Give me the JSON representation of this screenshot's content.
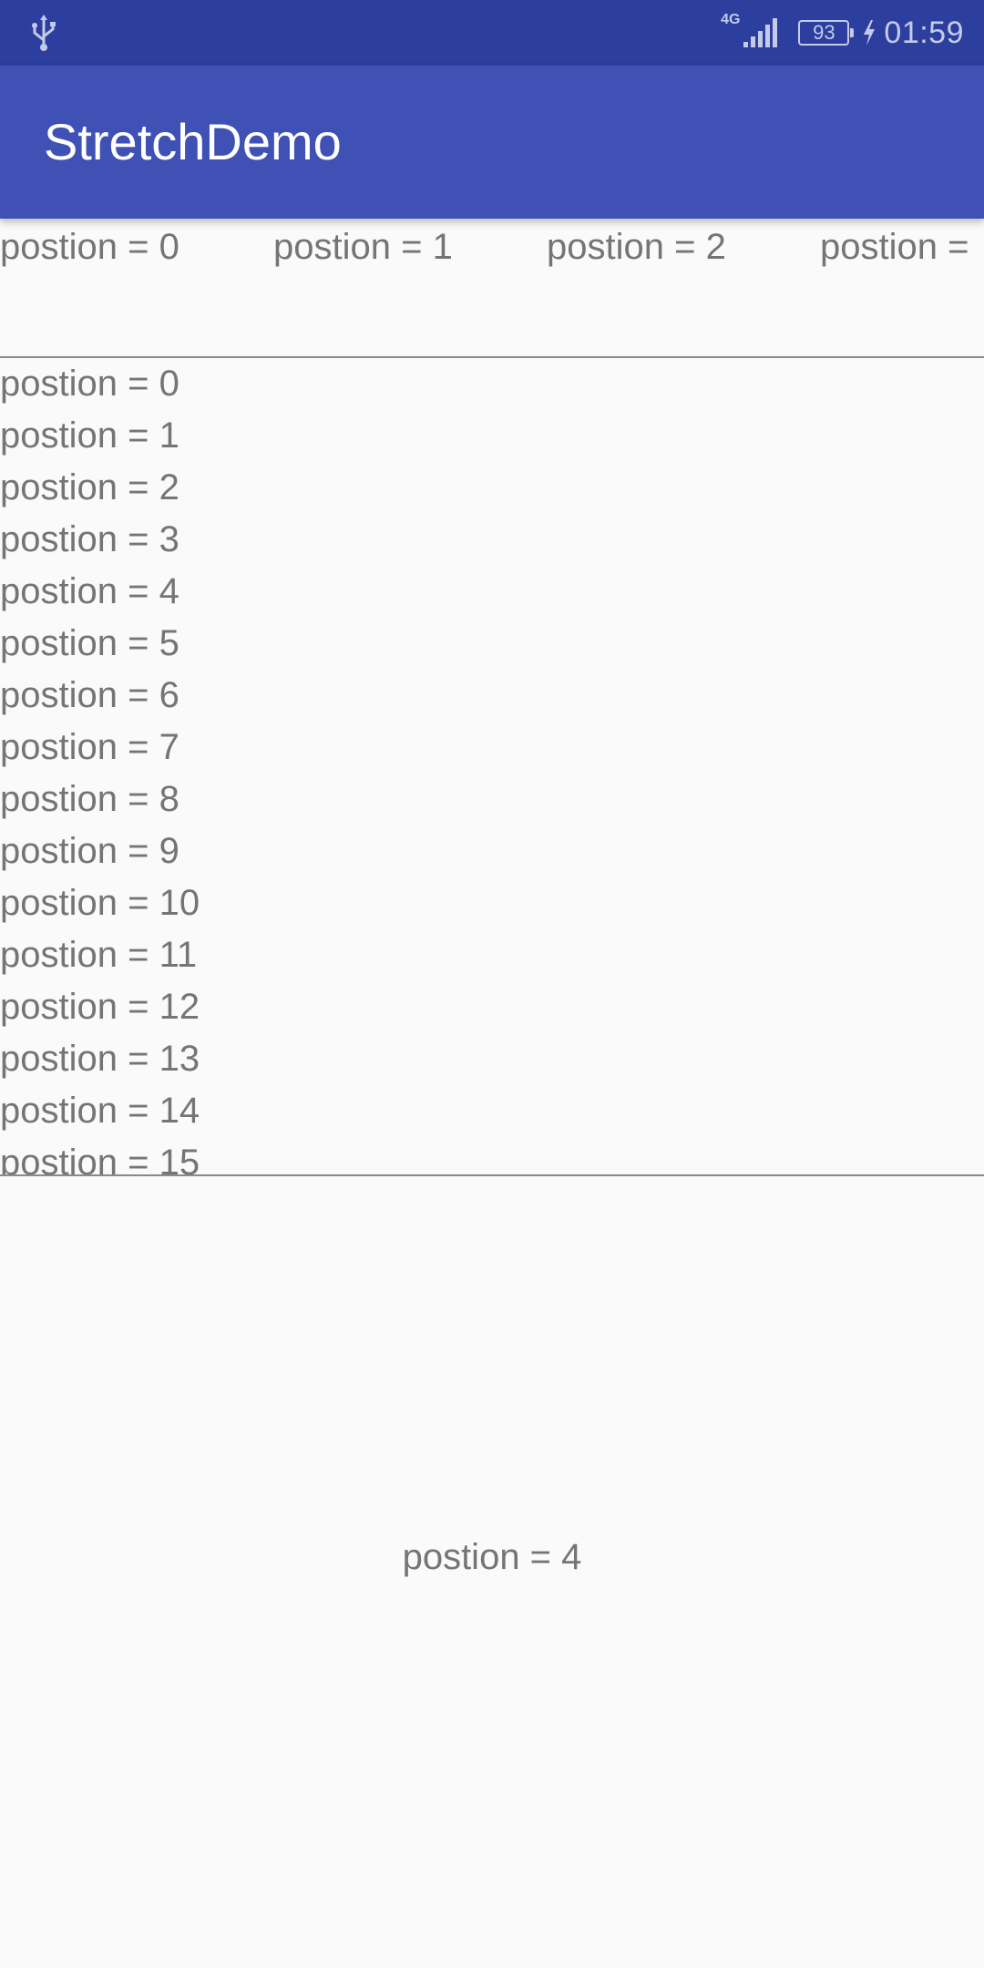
{
  "status_bar": {
    "network": "4G",
    "battery": "93",
    "time": "01:59",
    "icons": [
      "usb-icon",
      "signal-icon",
      "battery-icon",
      "charging-icon"
    ],
    "color": "#2C3E9E"
  },
  "app_bar": {
    "title": "StretchDemo",
    "color": "#3F51B5"
  },
  "horizontal_list": {
    "items": [
      "postion = 0",
      "postion = 1",
      "postion = 2",
      "postion ="
    ]
  },
  "vertical_list": {
    "items": [
      "postion = 0",
      "postion = 1",
      "postion = 2",
      "postion = 3",
      "postion = 4",
      "postion = 5",
      "postion = 6",
      "postion = 7",
      "postion = 8",
      "postion = 9",
      "postion = 10",
      "postion = 11",
      "postion = 12",
      "postion = 13",
      "postion = 14",
      "postion = 15"
    ]
  },
  "detail": {
    "text": "postion = 4"
  },
  "colors": {
    "background": "#FAFAFA",
    "text": "#757575",
    "divider": "#8A8A8A"
  }
}
